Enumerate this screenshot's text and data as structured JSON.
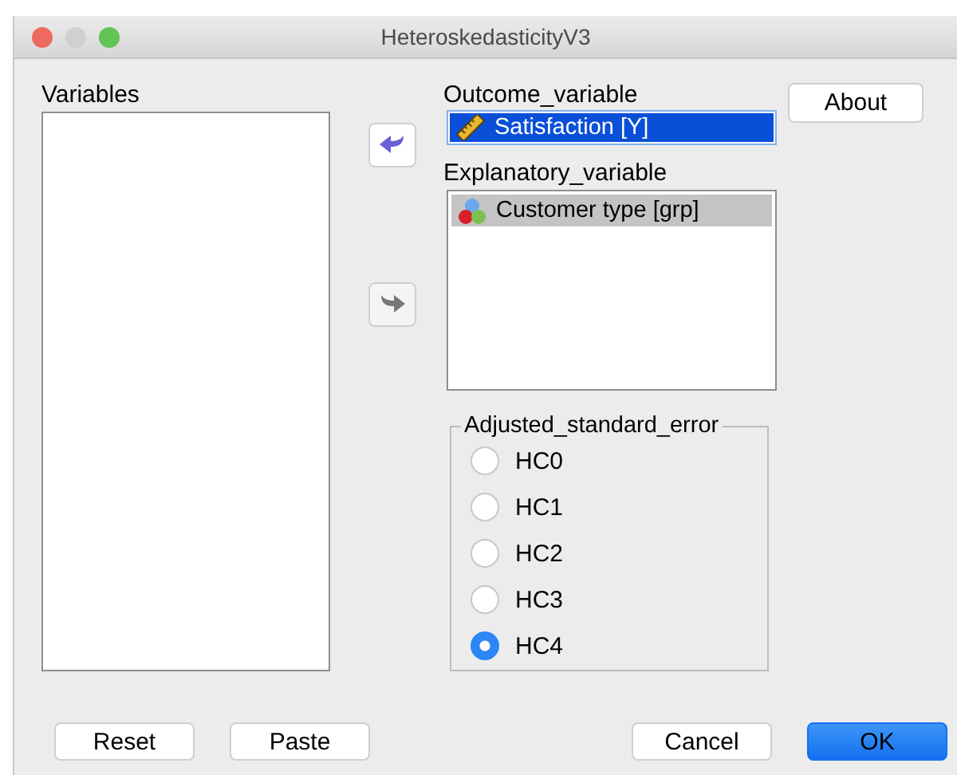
{
  "window": {
    "title": "HeteroskedasticityV3"
  },
  "variables": {
    "label": "Variables"
  },
  "move_buttons": [
    {
      "kind": "left",
      "disabled": false
    },
    {
      "kind": "right",
      "disabled": true
    }
  ],
  "outcome": {
    "label": "Outcome_variable",
    "focused": true,
    "items": [
      {
        "name": "Satisfaction [Y]",
        "kind": "scale",
        "selected": true
      }
    ]
  },
  "explanatory": {
    "label": "Explanatory_variable",
    "focused": false,
    "items": [
      {
        "name": "Customer type [grp]",
        "kind": "nominal",
        "selected": true
      }
    ]
  },
  "about_button": "About",
  "adjusted_standard_error": {
    "legend": "Adjusted_standard_error",
    "options": [
      {
        "label": "HC0",
        "selected": false
      },
      {
        "label": "HC1",
        "selected": false
      },
      {
        "label": "HC2",
        "selected": false
      },
      {
        "label": "HC3",
        "selected": false
      },
      {
        "label": "HC4",
        "selected": true
      }
    ]
  },
  "buttons": [
    {
      "label": "Reset",
      "default": false
    },
    {
      "label": "Paste",
      "default": false
    },
    {
      "label": "Cancel",
      "default": false
    },
    {
      "label": "OK",
      "default": true
    }
  ]
}
